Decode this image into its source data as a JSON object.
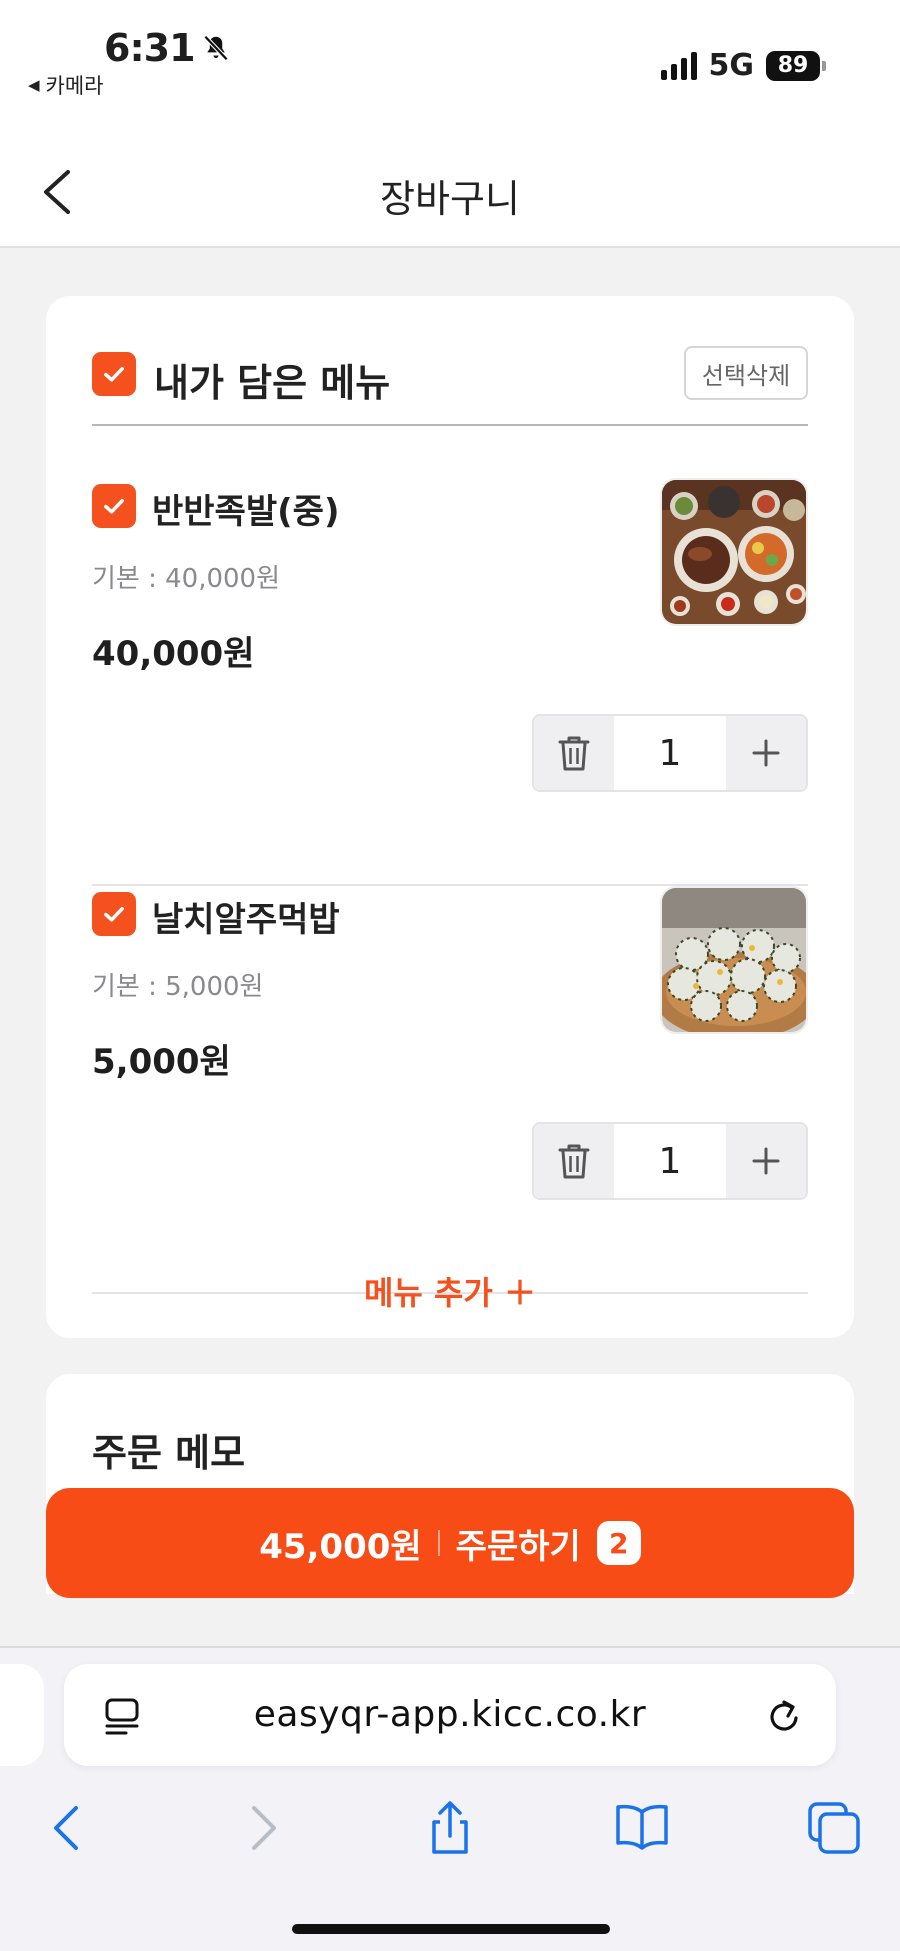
{
  "status_bar": {
    "time": "6:31",
    "back_app": "카메라",
    "network": "5G",
    "battery": "89"
  },
  "header": {
    "title": "장바구니"
  },
  "cart": {
    "title": "내가 담은 메뉴",
    "delete_selected": "선택삭제",
    "items": [
      {
        "name": "반반족발(중)",
        "base": "기본 : 40,000원",
        "price": "40,000원",
        "quantity": "1",
        "checked": true
      },
      {
        "name": "날치알주먹밥",
        "base": "기본 : 5,000원",
        "price": "5,000원",
        "quantity": "1",
        "checked": true
      }
    ],
    "add_menu": "메뉴 추가 ＋"
  },
  "memo": {
    "title": "주문 메모"
  },
  "order_button": {
    "total": "45,000원",
    "label": "주문하기",
    "count": "2"
  },
  "browser": {
    "url": "easyqr-app.kicc.co.kr"
  },
  "colors": {
    "accent": "#f84c16",
    "checkbox": "#f4511e",
    "ios_blue": "#1a73e8"
  }
}
